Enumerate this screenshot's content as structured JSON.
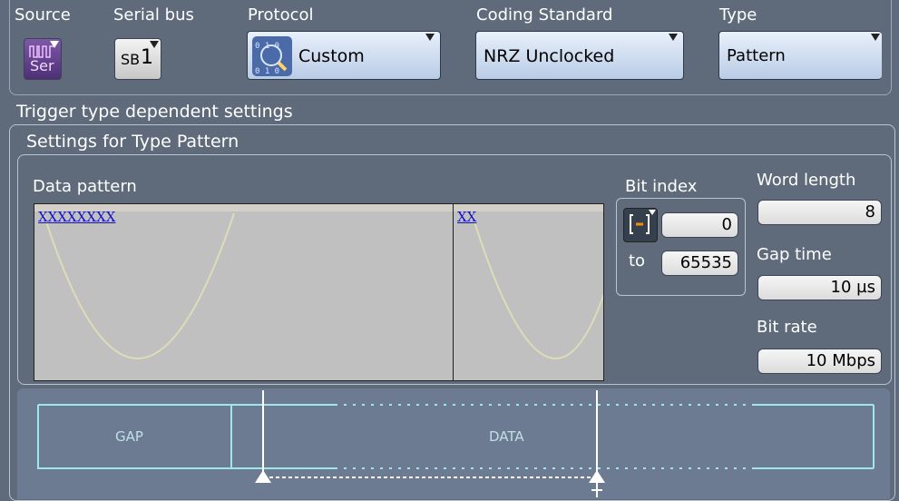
{
  "header": {
    "source_label": "Source",
    "source_icon_text": "Ser",
    "serialbus_label": "Serial bus",
    "serialbus_value_prefix": "SB",
    "serialbus_value_num": "1",
    "protocol_label": "Protocol",
    "protocol_value": "Custom",
    "coding_label": "Coding Standard",
    "coding_value": "NRZ Unclocked",
    "type_label": "Type",
    "type_value": "Pattern"
  },
  "trigger_settings_title": "Trigger type dependent settings",
  "type_settings_title": "Settings for Type Pattern",
  "data_pattern": {
    "label": "Data pattern",
    "pattern_left": "XXXXXXXX",
    "pattern_right": "XX"
  },
  "bit_index": {
    "label": "Bit index",
    "from_value": "0",
    "to_label": "to",
    "to_value": "65535"
  },
  "word_length": {
    "label": "Word length",
    "value": "8"
  },
  "gap_time": {
    "label": "Gap time",
    "value": "10 µs"
  },
  "bit_rate": {
    "label": "Bit rate",
    "value": "10 Mbps"
  },
  "diagram": {
    "gap_label": "GAP",
    "data_label": "DATA"
  },
  "colors": {
    "background": "#5f6b7b",
    "accent_blue": "#b9cce6",
    "diagram_line": "#9fe6e6",
    "pattern_text": "#1010d0"
  }
}
